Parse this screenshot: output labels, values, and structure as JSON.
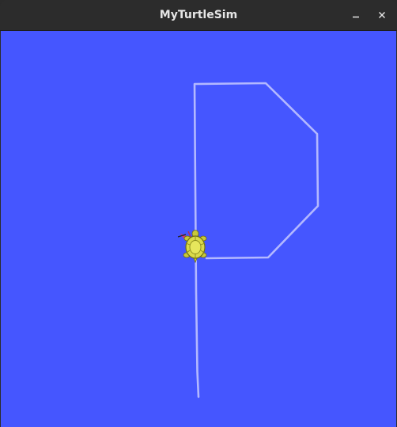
{
  "window": {
    "title": "MyTurtleSim",
    "buttons": [
      {
        "name": "minimize",
        "icon": "minimize-icon"
      },
      {
        "name": "close",
        "icon": "close-icon"
      }
    ]
  },
  "turtlesim": {
    "background_color": "#4556ff",
    "pen_color": "#b3b8ff",
    "turtle_icon": "turtle-icon",
    "path_shape": "letter P outline"
  }
}
